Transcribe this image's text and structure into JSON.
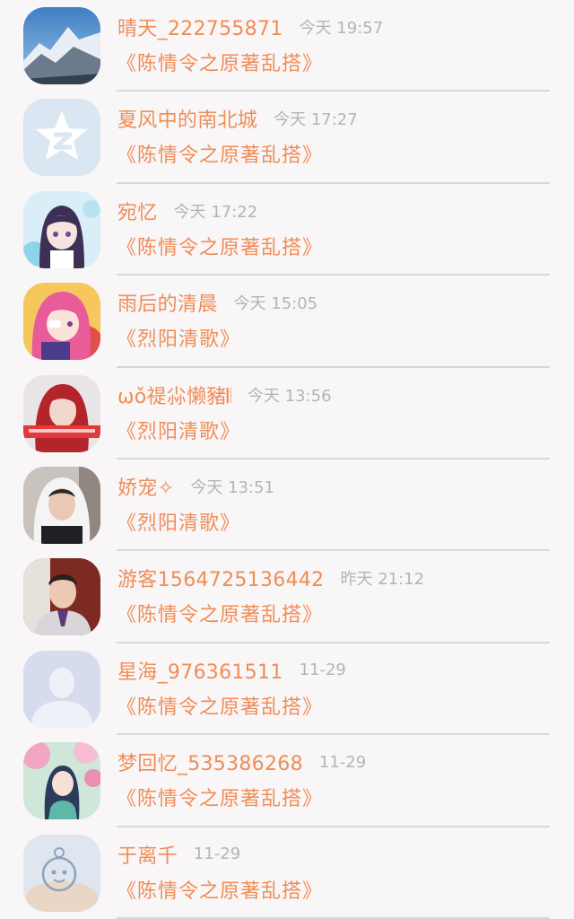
{
  "messages": [
    {
      "name": "晴天_222755871",
      "time": "今天 19:57",
      "book": "《陈情令之原著乱搭》",
      "avatar_icon": "snow-mountain-photo"
    },
    {
      "name": "夏风中的南北城",
      "time": "今天 17:27",
      "book": "《陈情令之原著乱搭》",
      "avatar_icon": "star-logo"
    },
    {
      "name": "宛忆",
      "time": "今天 17:22",
      "book": "《陈情令之原著乱搭》",
      "avatar_icon": "anime-girl-purple-hair"
    },
    {
      "name": "雨后的清晨",
      "time": "今天 15:05",
      "book": "《烈阳清歌》",
      "avatar_icon": "anime-girl-pink-hair"
    },
    {
      "name": "ωǒ禔尛懒豬𝄃",
      "time": "今天 13:56",
      "book": "《烈阳清歌》",
      "avatar_icon": "red-hair-woman-photo"
    },
    {
      "name": "娇宠✧",
      "time": "今天 13:51",
      "book": "《烈阳清歌》",
      "avatar_icon": "white-hood-person-photo"
    },
    {
      "name": "游客1564725136442",
      "time": "昨天 21:12",
      "book": "《陈情令之原著乱搭》",
      "avatar_icon": "man-in-suit-photo"
    },
    {
      "name": "星海_976361511",
      "time": "11-29",
      "book": "《陈情令之原著乱搭》",
      "avatar_icon": "default-user-silhouette"
    },
    {
      "name": "梦回忆_535386268",
      "time": "11-29",
      "book": "《陈情令之原著乱搭》",
      "avatar_icon": "anime-girl-blossoms"
    },
    {
      "name": "于离千",
      "time": "11-29",
      "book": "《陈情令之原著乱搭》",
      "avatar_icon": "cartoon-character-sketch"
    }
  ],
  "colors": {
    "accent": "#ef8d57",
    "timestamp": "#b6b3b5",
    "divider": "#d9d6d7",
    "background": "#f9f6f7"
  }
}
